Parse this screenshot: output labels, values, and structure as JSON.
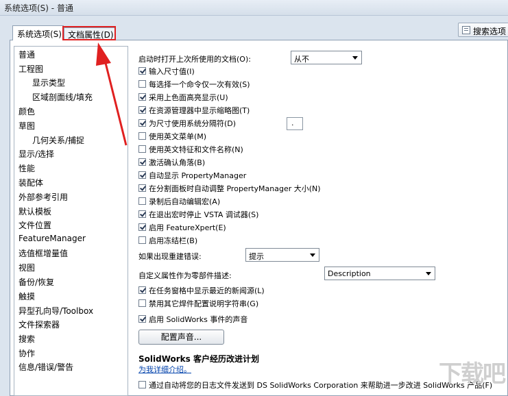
{
  "window": {
    "title": "系统选项(S) - 普通"
  },
  "tabs": {
    "system": "系统选项(S)",
    "document": "文档属性(D)"
  },
  "search_button": {
    "label": "搜索选项"
  },
  "sidebar": {
    "items": [
      "普通",
      "工程图",
      "显示类型",
      "区域剖面线/填充",
      "颜色",
      "草图",
      "几何关系/捕捉",
      "显示/选择",
      "性能",
      "装配体",
      "外部参考引用",
      "默认模板",
      "文件位置",
      "FeatureManager",
      "选值框增量值",
      "视图",
      "备份/恢复",
      "触摸",
      "异型孔向导/Toolbox",
      "文件探索器",
      "搜索",
      "协作",
      "信息/错误/警告"
    ]
  },
  "settings": {
    "open_last_docs_label": "启动时打开上次所使用的文档(O):",
    "open_last_docs_value": "从不",
    "checkboxes": [
      {
        "label": "输入尺寸值(I)",
        "checked": true
      },
      {
        "label": "每选择一个命令仅一次有效(S)",
        "checked": false
      },
      {
        "label": "采用上色面高亮显示(U)",
        "checked": true
      },
      {
        "label": "在资源管理器中显示缩略图(T)",
        "checked": true
      },
      {
        "label": "为尺寸使用系统分隔符(D)",
        "checked": true
      },
      {
        "label": "使用英文菜单(M)",
        "checked": false
      },
      {
        "label": "使用英文特征和文件名称(N)",
        "checked": false
      },
      {
        "label": "激活确认角落(B)",
        "checked": true
      },
      {
        "label": "自动显示 PropertyManager",
        "checked": true
      },
      {
        "label": "在分割面板时自动调整 PropertyManager 大小(N)",
        "checked": true
      },
      {
        "label": "录制后自动编辑宏(A)",
        "checked": false
      },
      {
        "label": "在退出宏时停止 VSTA 调试器(S)",
        "checked": true
      },
      {
        "label": "启用 FeatureXpert(E)",
        "checked": true
      },
      {
        "label": "启用冻结栏(B)",
        "checked": false
      }
    ],
    "separator_value": ".",
    "rebuild_error_label": "如果出现重建错误:",
    "rebuild_error_value": "提示",
    "custom_prop_label": "自定义属性作为零部件描述:",
    "custom_prop_value": "Description",
    "checkboxes2": [
      {
        "label": "在任务窗格中显示最近的新闻源(L)",
        "checked": true
      },
      {
        "label": "禁用其它焊件配置说明字符串(G)",
        "checked": false
      },
      {
        "label": "启用 SolidWorks 事件的声音",
        "checked": true
      }
    ],
    "sound_button": "配置声音...",
    "ceip_title": "SolidWorks 客户经历改进计划",
    "ceip_link": "为我详细介绍。",
    "ceip_checkbox": {
      "label": "通过自动将您的日志文件发送到 DS SolidWorks Corporation 来帮助进一步改进 SolidWorks 产品(F)",
      "checked": false
    }
  },
  "annotation_color": "#e02020",
  "watermark_text": "下载吧"
}
